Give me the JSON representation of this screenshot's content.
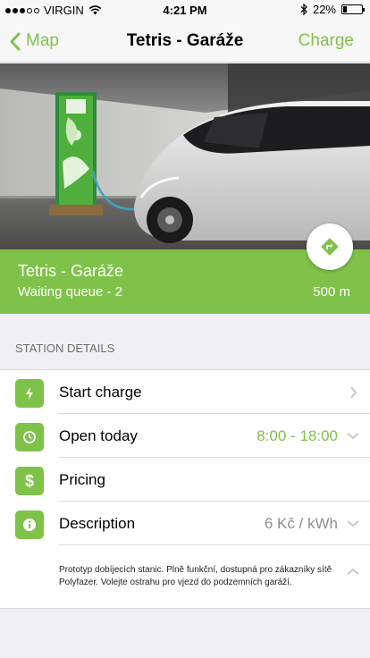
{
  "status_bar": {
    "carrier": "VIRGIN",
    "time": "4:21 PM",
    "battery": "22%",
    "battery_level": 0.22
  },
  "nav": {
    "back_label": "Map",
    "title": "Tetris - Garáže",
    "action_label": "Charge"
  },
  "station": {
    "name": "Tetris - Garáže",
    "queue": "Waiting queue - 2",
    "distance": "500 m"
  },
  "details": {
    "header": "STATION DETAILS",
    "rows": [
      {
        "label": "Start charge",
        "value": "",
        "icon": "bolt-icon",
        "accessory": "chevron-right-icon"
      },
      {
        "label": "Open today",
        "value": "8:00 - 18:00",
        "icon": "clock-icon",
        "accessory": "chevron-down-icon"
      },
      {
        "label": "Pricing",
        "value": "",
        "icon": "dollar-icon",
        "accessory": ""
      },
      {
        "label": "Description",
        "value": "6 Kč / kWh",
        "icon": "info-icon",
        "accessory": "chevron-down-icon"
      }
    ],
    "description": "Prototyp dobíjecích stanic. Plně funkční, dostupná pro zákazníky sítě Polyfazer. Volejte ostrahu pro vjezd do podzemních garáží."
  },
  "colors": {
    "accent": "#7fc24a",
    "nav_background": "#f7f7f7",
    "page_background": "#efeff4"
  }
}
